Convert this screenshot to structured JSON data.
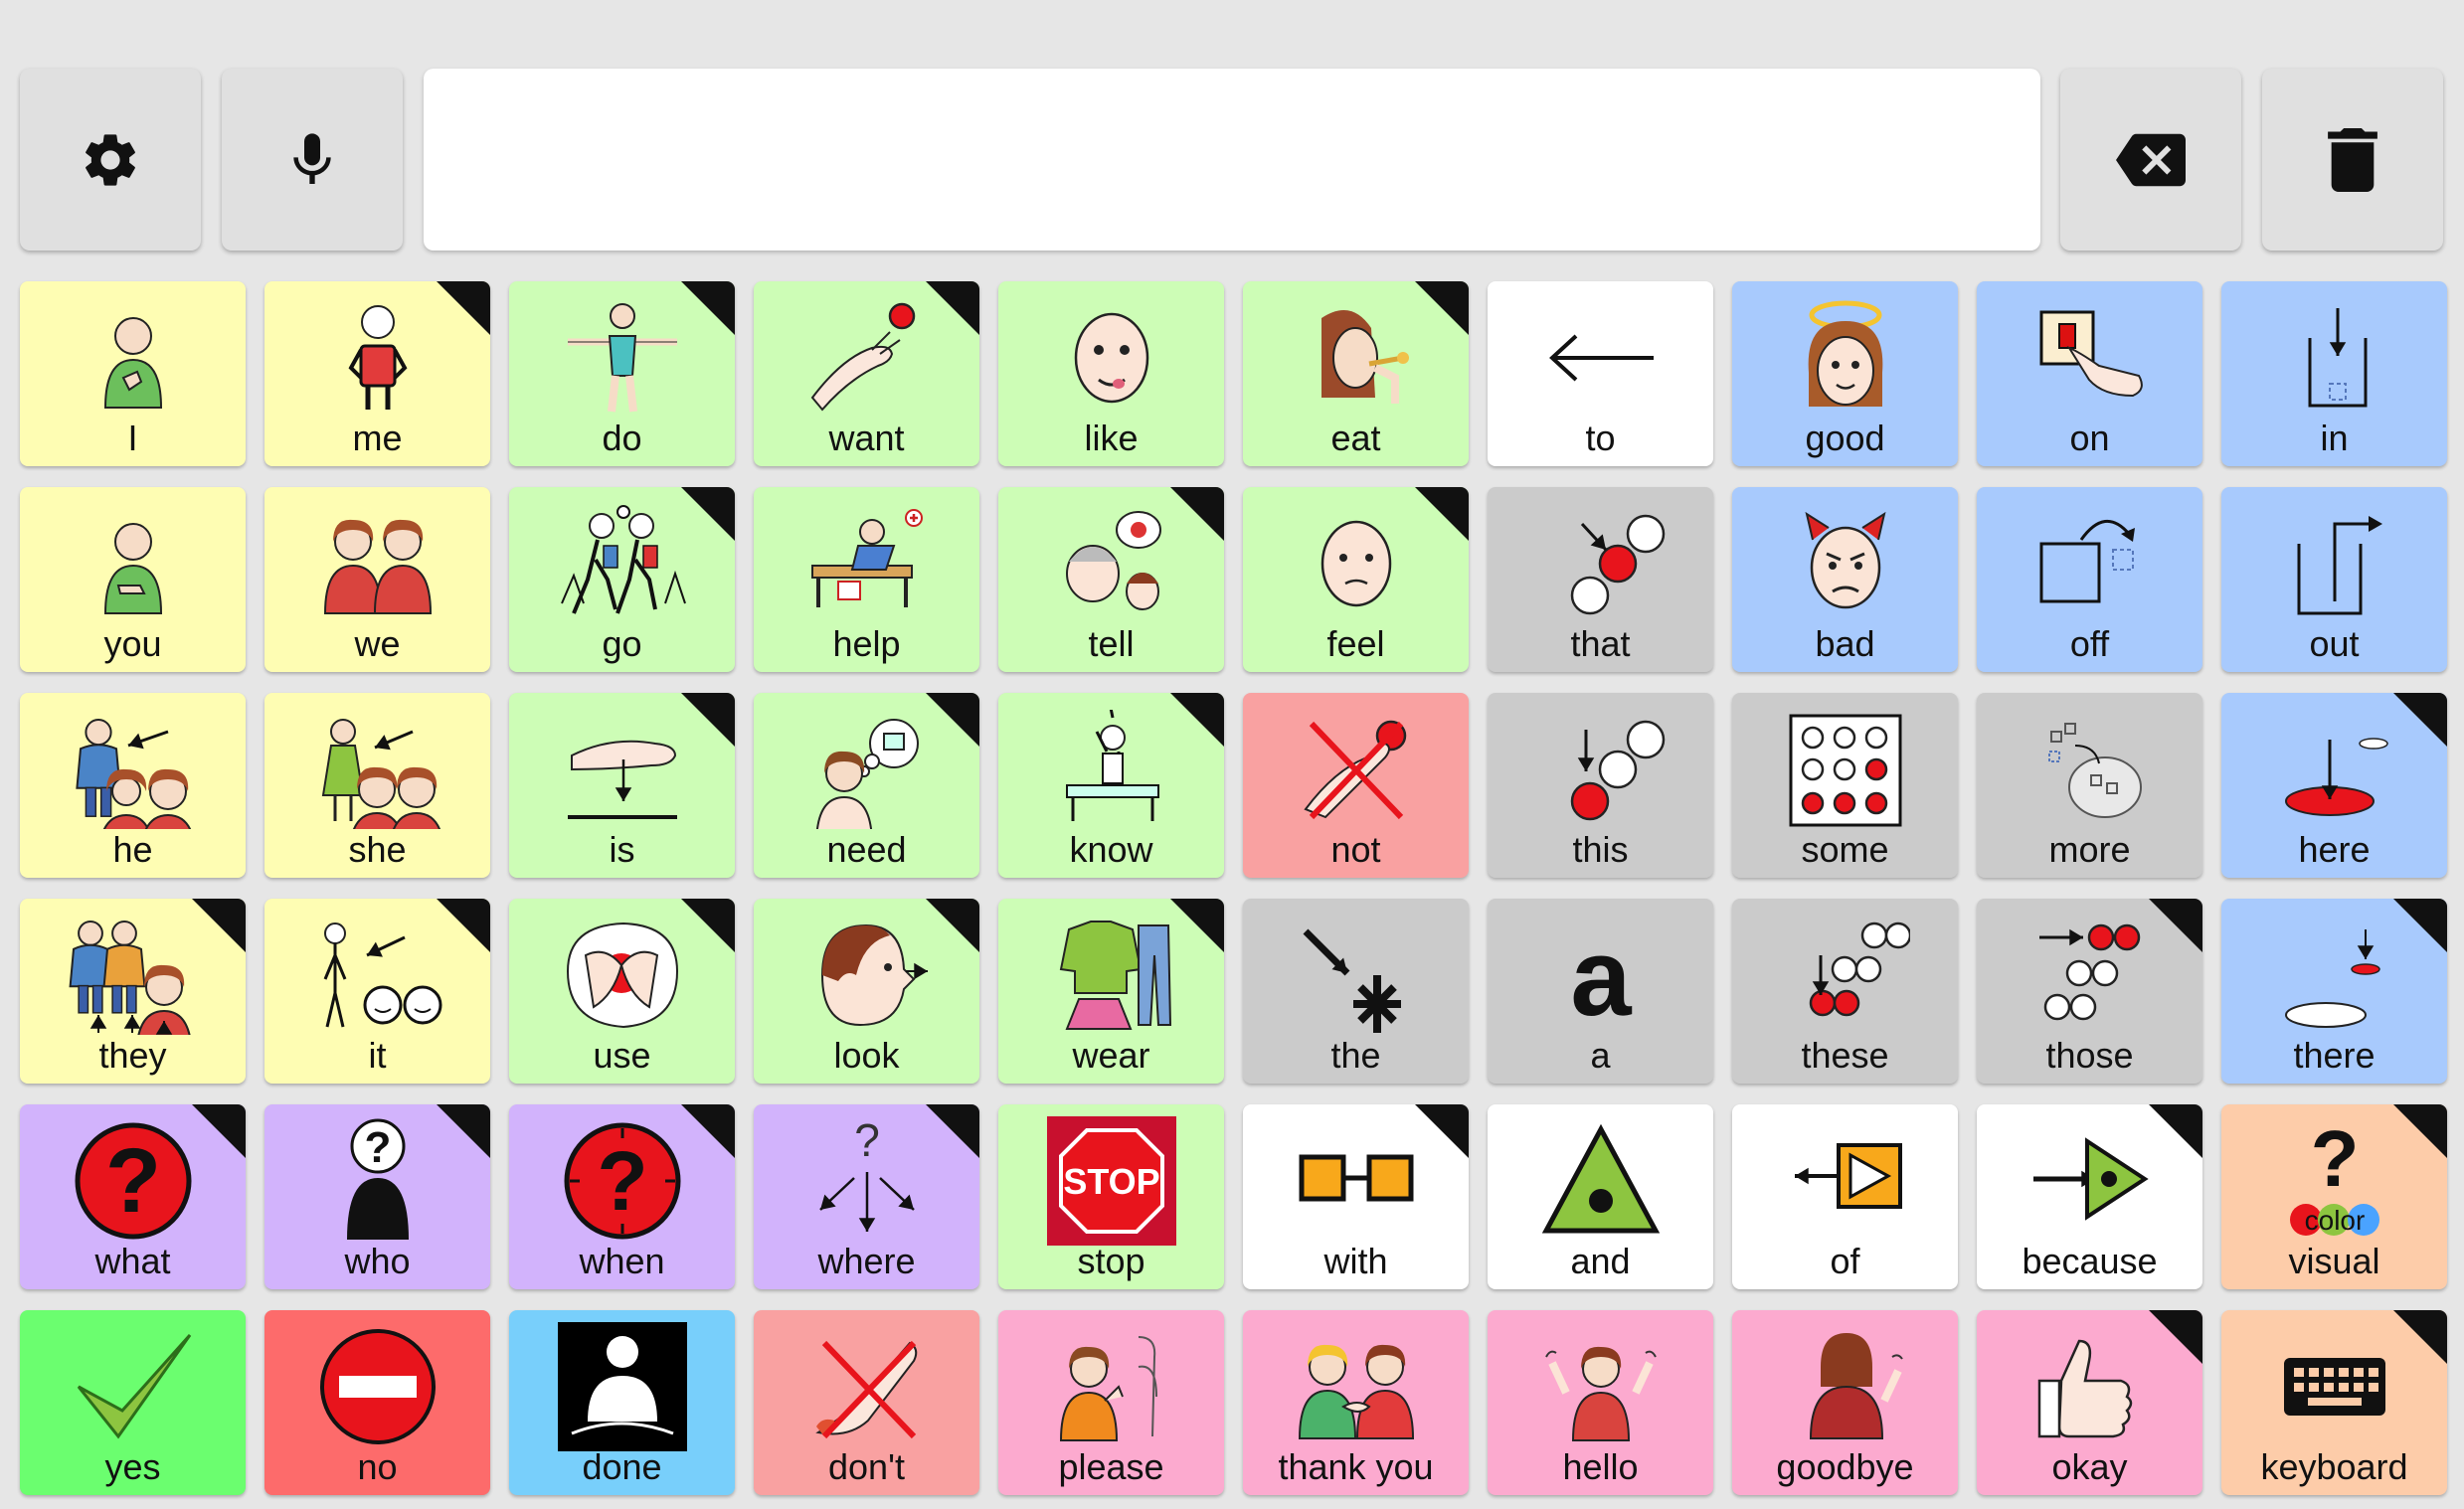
{
  "toolbar": {
    "settings_icon": "gear-icon",
    "mic_icon": "microphone-icon",
    "message": "",
    "backspace_icon": "backspace-icon",
    "clear_icon": "trash-icon"
  },
  "colors": {
    "yellow": "#fefdb3",
    "green": "#cdfdb6",
    "white": "#ffffff",
    "blue": "#a8cafd",
    "gray": "#cbcbcb",
    "red": "#f9a1a1",
    "purple": "#d2b3fc",
    "orange": "#fdcca9",
    "yes": "#6bfe6f",
    "no": "#fd6b6b",
    "done": "#78cffb",
    "pink": "#fcaacf"
  },
  "rows": [
    [
      {
        "label": "I",
        "icon": "person-self-icon"
      },
      {
        "label": "me",
        "icon": "person-me-icon",
        "folder": true
      },
      {
        "label": "do",
        "icon": "person-do-icon",
        "folder": true
      },
      {
        "label": "want",
        "icon": "hand-reach-icon",
        "folder": true
      },
      {
        "label": "like",
        "icon": "face-like-icon"
      },
      {
        "label": "eat",
        "icon": "person-eat-icon",
        "folder": true
      },
      {
        "label": "to",
        "icon": "arrow-left-icon"
      },
      {
        "label": "good",
        "icon": "angel-face-icon"
      },
      {
        "label": "on",
        "icon": "switch-on-icon"
      },
      {
        "label": "in",
        "icon": "arrow-in-icon"
      }
    ],
    [
      {
        "label": "you",
        "icon": "person-point-icon"
      },
      {
        "label": "we",
        "icon": "two-people-icon"
      },
      {
        "label": "go",
        "icon": "walking-people-icon",
        "folder": true
      },
      {
        "label": "help",
        "icon": "helping-icon"
      },
      {
        "label": "tell",
        "icon": "talking-people-icon",
        "folder": true
      },
      {
        "label": "feel",
        "icon": "face-feel-icon",
        "folder": true
      },
      {
        "label": "that",
        "icon": "dots-that-icon"
      },
      {
        "label": "bad",
        "icon": "devil-face-icon"
      },
      {
        "label": "off",
        "icon": "box-off-icon"
      },
      {
        "label": "out",
        "icon": "arrow-out-icon"
      }
    ],
    [
      {
        "label": "he",
        "icon": "person-he-icon"
      },
      {
        "label": "she",
        "icon": "person-she-icon"
      },
      {
        "label": "is",
        "icon": "hand-is-icon",
        "folder": true
      },
      {
        "label": "need",
        "icon": "thinking-need-icon",
        "folder": true
      },
      {
        "label": "know",
        "icon": "desk-know-icon",
        "folder": true
      },
      {
        "label": "not",
        "icon": "not-cross-icon"
      },
      {
        "label": "this",
        "icon": "dots-this-icon"
      },
      {
        "label": "some",
        "icon": "dots-some-icon"
      },
      {
        "label": "more",
        "icon": "more-icon"
      },
      {
        "label": "here",
        "icon": "location-here-icon",
        "folder": true
      }
    ],
    [
      {
        "label": "they",
        "icon": "people-they-icon",
        "folder": true
      },
      {
        "label": "it",
        "icon": "person-it-icon",
        "folder": true
      },
      {
        "label": "use",
        "icon": "hands-use-icon",
        "folder": true
      },
      {
        "label": "look",
        "icon": "face-look-icon",
        "folder": true
      },
      {
        "label": "wear",
        "icon": "clothes-icon",
        "folder": true
      },
      {
        "label": "the",
        "icon": "arrow-asterisk-icon"
      },
      {
        "label": "a",
        "icon": "letter-a-icon"
      },
      {
        "label": "these",
        "icon": "dots-these-icon"
      },
      {
        "label": "those",
        "icon": "dots-those-icon",
        "folder": true
      },
      {
        "label": "there",
        "icon": "location-there-icon",
        "folder": true
      }
    ],
    [
      {
        "label": "what",
        "icon": "question-red-icon",
        "folder": true
      },
      {
        "label": "who",
        "icon": "person-question-icon",
        "folder": true
      },
      {
        "label": "when",
        "icon": "clock-question-icon",
        "folder": true
      },
      {
        "label": "where",
        "icon": "arrows-where-icon",
        "folder": true
      },
      {
        "label": "stop",
        "icon": "stop-sign-icon"
      },
      {
        "label": "with",
        "icon": "boxes-linked-icon",
        "folder": true
      },
      {
        "label": "and",
        "icon": "triangle-dot-icon"
      },
      {
        "label": "of",
        "icon": "arrow-box-icon"
      },
      {
        "label": "because",
        "icon": "arrow-triangle-icon",
        "folder": true
      },
      {
        "label": "visual",
        "icon": "color-question-icon",
        "folder": true
      }
    ],
    [
      {
        "label": "yes",
        "icon": "checkmark-icon"
      },
      {
        "label": "no",
        "icon": "no-entry-icon"
      },
      {
        "label": "done",
        "icon": "done-icon"
      },
      {
        "label": "don't",
        "icon": "dont-icon"
      },
      {
        "label": "please",
        "icon": "please-icon"
      },
      {
        "label": "thank you",
        "icon": "handshake-icon"
      },
      {
        "label": "hello",
        "icon": "wave-hello-icon"
      },
      {
        "label": "goodbye",
        "icon": "wave-goodbye-icon"
      },
      {
        "label": "okay",
        "icon": "thumbs-up-icon",
        "folder": true
      },
      {
        "label": "keyboard",
        "icon": "keyboard-icon",
        "folder": true
      }
    ]
  ]
}
